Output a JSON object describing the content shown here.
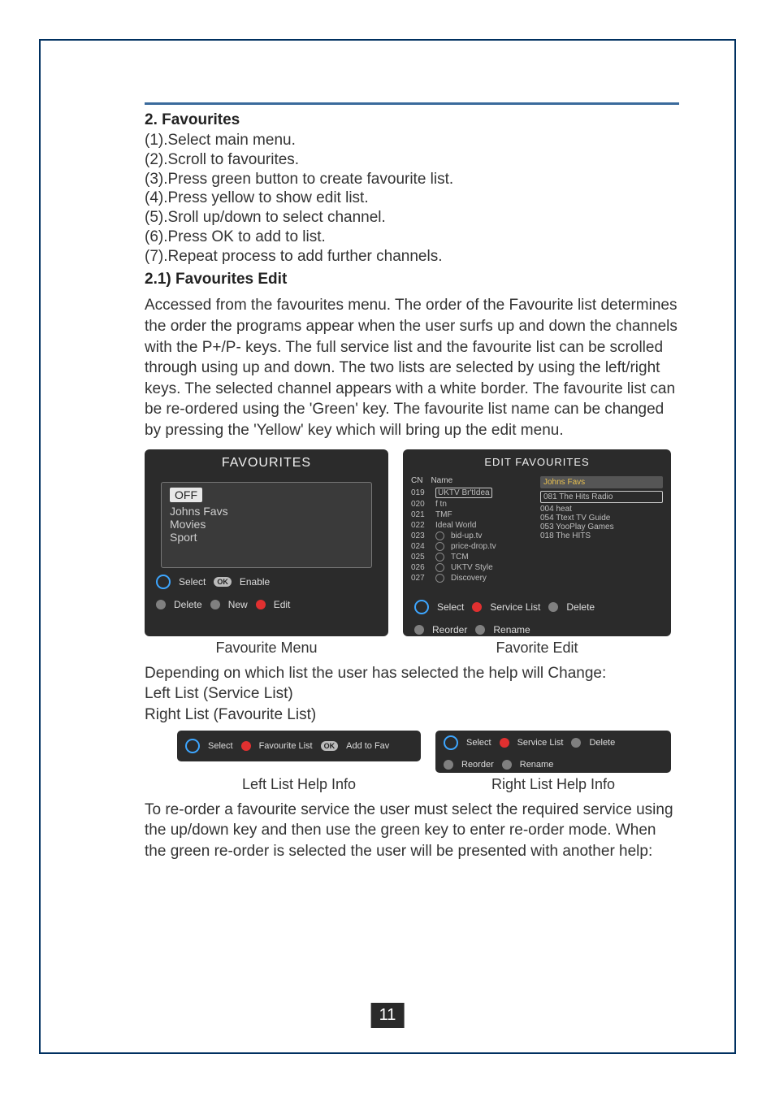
{
  "section": {
    "h_fav": "2. Favourites",
    "steps": {
      "s1": "(1).Select main menu.",
      "s2": "(2).Scroll to favourites.",
      "s3": "(3).Press green button to create favourite list.",
      "s4": "(4).Press yellow to show edit list.",
      "s5": "(5).Sroll up/down to select channel.",
      "s6": "(6).Press OK to add to list.",
      "s7": "(7).Repeat process to add further channels."
    },
    "h_edit": "2.1) Favourites Edit",
    "para_edit": "Accessed from the favourites menu. The order of the Favourite list determines the order the programs appear when the user surfs up and down the channels with the P+/P- keys. The full service list and the favourite list can be scrolled through using up and down. The two lists are selected by using the left/right keys. The selected channel appears with a white border. The favourite list can be re-ordered using the 'Green' key. The favourite list name can be changed by pressing the 'Yellow' key which will bring up the edit menu.",
    "para_depend1": "Depending on which list the user has selected the help will Change:",
    "para_depend2": "Left List (Service List)",
    "para_depend3": "Right List (Favourite List)",
    "para_reorder": "To re-order a favourite service the user must select the required service using the up/down key and then use the green key to enter re-order mode. When the green re-order is selected the user will be presented with another help:"
  },
  "favPanel": {
    "title": "FAVOURITES",
    "items": {
      "i0": "OFF",
      "i1": "Johns Favs",
      "i2": "Movies",
      "i3": "Sport"
    },
    "help": {
      "select": "Select",
      "enable": "Enable",
      "delete": "Delete",
      "new": "New",
      "edit": "Edit",
      "ok": "OK"
    },
    "caption": "Favourite Menu"
  },
  "editPanel": {
    "title": "EDIT FAVOURITES",
    "left": {
      "hdr_cn": "CN",
      "hdr_name": "Name",
      "rows": [
        {
          "cn": "019",
          "name": "UKTV Br'tIdea"
        },
        {
          "cn": "020",
          "name": "f tn"
        },
        {
          "cn": "021",
          "name": "TMF"
        },
        {
          "cn": "022",
          "name": "Ideal World"
        },
        {
          "cn": "023",
          "name": "bid-up.tv"
        },
        {
          "cn": "024",
          "name": "price-drop.tv"
        },
        {
          "cn": "025",
          "name": "TCM"
        },
        {
          "cn": "026",
          "name": "UKTV Style"
        },
        {
          "cn": "027",
          "name": "Discovery"
        }
      ]
    },
    "right": {
      "title": "Johns Favs",
      "rows": [
        "081  The Hits Radio",
        "004  heat",
        "054  Ttext TV Guide",
        "053  YooPlay Games",
        "018  The HITS"
      ]
    },
    "help": {
      "select": "Select",
      "svc": "Service List",
      "delete": "Delete",
      "reorder": "Reorder",
      "rename": "Rename"
    },
    "caption": "Favorite Edit"
  },
  "leftHelp": {
    "select": "Select",
    "favlist": "Favourite List",
    "add": "Add to Fav",
    "ok": "OK",
    "caption": "Left List Help Info"
  },
  "rightHelp": {
    "select": "Select",
    "svc": "Service List",
    "delete": "Delete",
    "reorder": "Reorder",
    "rename": "Rename",
    "caption": "Right List Help Info"
  },
  "page_number": "11"
}
